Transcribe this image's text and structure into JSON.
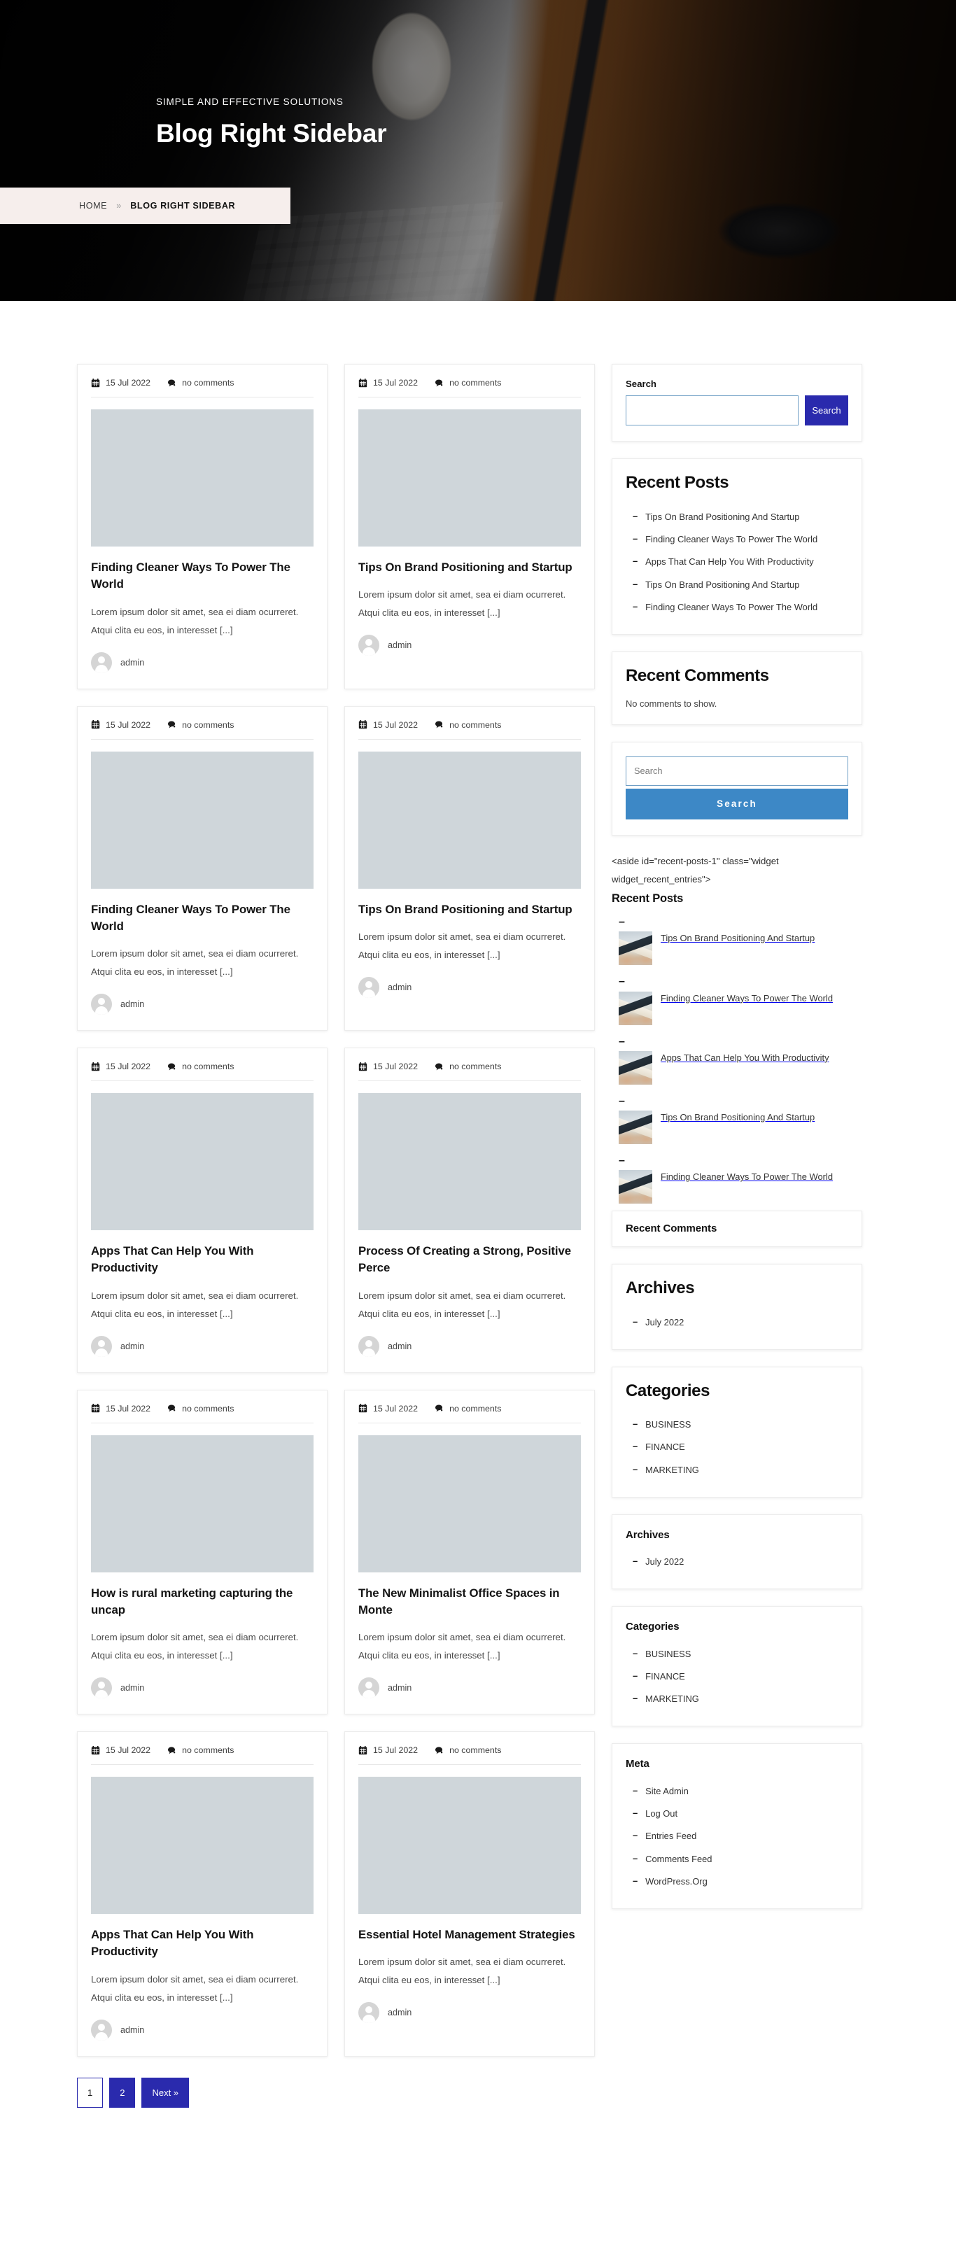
{
  "hero": {
    "eyebrow": "SIMPLE AND EFFECTIVE SOLUTIONS",
    "title": "Blog Right Sidebar",
    "breadcrumb": {
      "home": "HOME",
      "separator": "»",
      "current": "BLOG RIGHT SIDEBAR"
    }
  },
  "posts": [
    {
      "date": "15 Jul 2022",
      "comments": "no comments",
      "title": "Finding Cleaner Ways To Power The World",
      "excerpt": "Lorem ipsum dolor sit amet, sea ei diam ocurreret. Atqui clita eu eos, in interesset [...]",
      "author": "admin"
    },
    {
      "date": "15 Jul 2022",
      "comments": "no comments",
      "title": "Tips On Brand Positioning and Startup",
      "excerpt": "Lorem ipsum dolor sit amet, sea ei diam ocurreret. Atqui clita eu eos, in interesset [...]",
      "author": "admin"
    },
    {
      "date": "15 Jul 2022",
      "comments": "no comments",
      "title": "Finding Cleaner Ways To Power The World",
      "excerpt": "Lorem ipsum dolor sit amet, sea ei diam ocurreret. Atqui clita eu eos, in interesset [...]",
      "author": "admin"
    },
    {
      "date": "15 Jul 2022",
      "comments": "no comments",
      "title": "Tips On Brand Positioning and Startup",
      "excerpt": "Lorem ipsum dolor sit amet, sea ei diam ocurreret. Atqui clita eu eos, in interesset [...]",
      "author": "admin"
    },
    {
      "date": "15 Jul 2022",
      "comments": "no comments",
      "title": "Apps That Can Help You With Productivity",
      "excerpt": "Lorem ipsum dolor sit amet, sea ei diam ocurreret. Atqui clita eu eos, in interesset [...]",
      "author": "admin"
    },
    {
      "date": "15 Jul 2022",
      "comments": "no comments",
      "title": "Process Of Creating a Strong, Positive Perce",
      "excerpt": "Lorem ipsum dolor sit amet, sea ei diam ocurreret. Atqui clita eu eos, in interesset [...]",
      "author": "admin"
    },
    {
      "date": "15 Jul 2022",
      "comments": "no comments",
      "title": "How is rural marketing capturing the uncap",
      "excerpt": "Lorem ipsum dolor sit amet, sea ei diam ocurreret. Atqui clita eu eos, in interesset [...]",
      "author": "admin"
    },
    {
      "date": "15 Jul 2022",
      "comments": "no comments",
      "title": "The New Minimalist Office Spaces in Monte",
      "excerpt": "Lorem ipsum dolor sit amet, sea ei diam ocurreret. Atqui clita eu eos, in interesset [...]",
      "author": "admin"
    },
    {
      "date": "15 Jul 2022",
      "comments": "no comments",
      "title": "Apps That Can Help You With Productivity",
      "excerpt": "Lorem ipsum dolor sit amet, sea ei diam ocurreret. Atqui clita eu eos, in interesset [...]",
      "author": "admin"
    },
    {
      "date": "15 Jul 2022",
      "comments": "no comments",
      "title": "Essential Hotel Management Strategies",
      "excerpt": "Lorem ipsum dolor sit amet, sea ei diam ocurreret. Atqui clita eu eos, in interesset [...]",
      "author": "admin"
    }
  ],
  "pagination": [
    {
      "label": "1",
      "state": "current"
    },
    {
      "label": "2",
      "state": "link"
    },
    {
      "label": "Next »",
      "state": "link"
    }
  ],
  "sidebar": {
    "search_widget": {
      "label": "Search",
      "input_value": "",
      "button_label": "Search"
    },
    "recent_posts": {
      "title": "Recent Posts",
      "items": [
        "Tips On Brand Positioning And Startup",
        "Finding Cleaner Ways To Power The World",
        "Apps That Can Help You With Productivity",
        "Tips On Brand Positioning And Startup",
        "Finding Cleaner Ways To Power The World"
      ]
    },
    "recent_comments": {
      "title": "Recent Comments",
      "empty": "No comments to show."
    },
    "search_widget_2": {
      "placeholder": "Search",
      "input_value": "",
      "button_label": "Search"
    },
    "raw_markup_widget": {
      "raw": "<aside id=\"recent-posts-1\" class=\"widget widget_recent_entries\">",
      "title": "Recent Posts",
      "items": [
        "Tips On Brand Positioning And Startup",
        "Finding Cleaner Ways To Power The World",
        "Apps That Can Help You With Productivity",
        "Tips On Brand Positioning And Startup",
        "Finding Cleaner Ways To Power The World"
      ]
    },
    "recent_comments_2": {
      "title": "Recent Comments"
    },
    "archives_large": {
      "title": "Archives",
      "items": [
        "July 2022"
      ]
    },
    "categories_large": {
      "title": "Categories",
      "items": [
        "BUSINESS",
        "FINANCE",
        "MARKETING"
      ]
    },
    "archives_small": {
      "title": "Archives",
      "items": [
        "July 2022"
      ]
    },
    "categories_small": {
      "title": "Categories",
      "items": [
        "BUSINESS",
        "FINANCE",
        "MARKETING"
      ]
    },
    "meta": {
      "title": "Meta",
      "items": [
        "Site Admin",
        "Log Out",
        "Entries Feed",
        "Comments Feed",
        "WordPress.Org"
      ]
    }
  },
  "icons": {
    "calendar": "calendar-icon",
    "comment": "comment-icon"
  },
  "colors": {
    "primary_blue": "#2a2aad",
    "secondary_blue": "#3d88c6",
    "breadcrumb_bg": "#f6eeec",
    "input_border": "#6f9ec5"
  }
}
